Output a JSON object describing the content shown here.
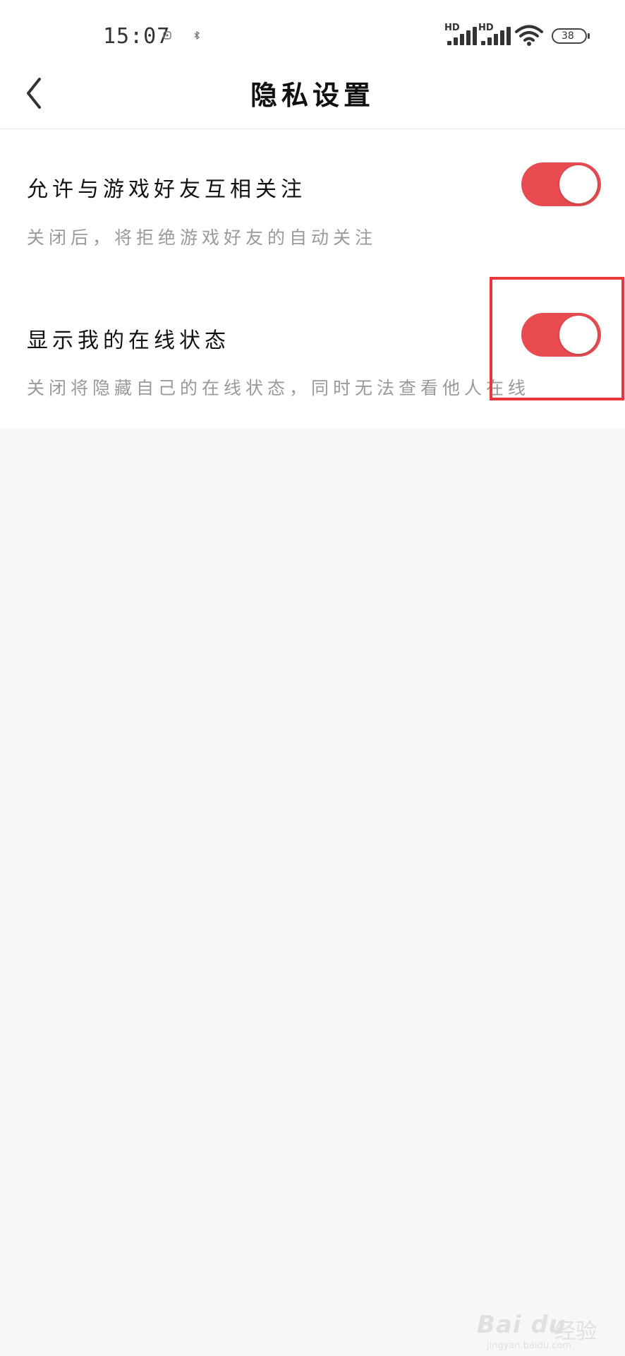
{
  "status_bar": {
    "time": "15:07",
    "signal1_label": "HD",
    "signal2_label": "HD",
    "battery": "38",
    "icons": [
      "alarm-icon",
      "bluetooth-icon",
      "signal-icon",
      "signal-icon",
      "wifi-icon",
      "battery-icon"
    ]
  },
  "header": {
    "title": "隐私设置",
    "back_icon": "chevron-left-icon"
  },
  "settings": [
    {
      "title": "允许与游戏好友互相关注",
      "description": "关闭后，将拒绝游戏好友的自动关注",
      "enabled": true
    },
    {
      "title": "显示我的在线状态",
      "description": "关闭将隐藏自己的在线状态，同时无法查看他人在线",
      "enabled": true
    }
  ],
  "colors": {
    "toggle_on": "#e84b50",
    "highlight": "#e8383d",
    "page_background": "#f7f7f7"
  },
  "watermark": {
    "brand": "Bai du",
    "sub": "经验",
    "url": "jingyan.baidu.com"
  }
}
